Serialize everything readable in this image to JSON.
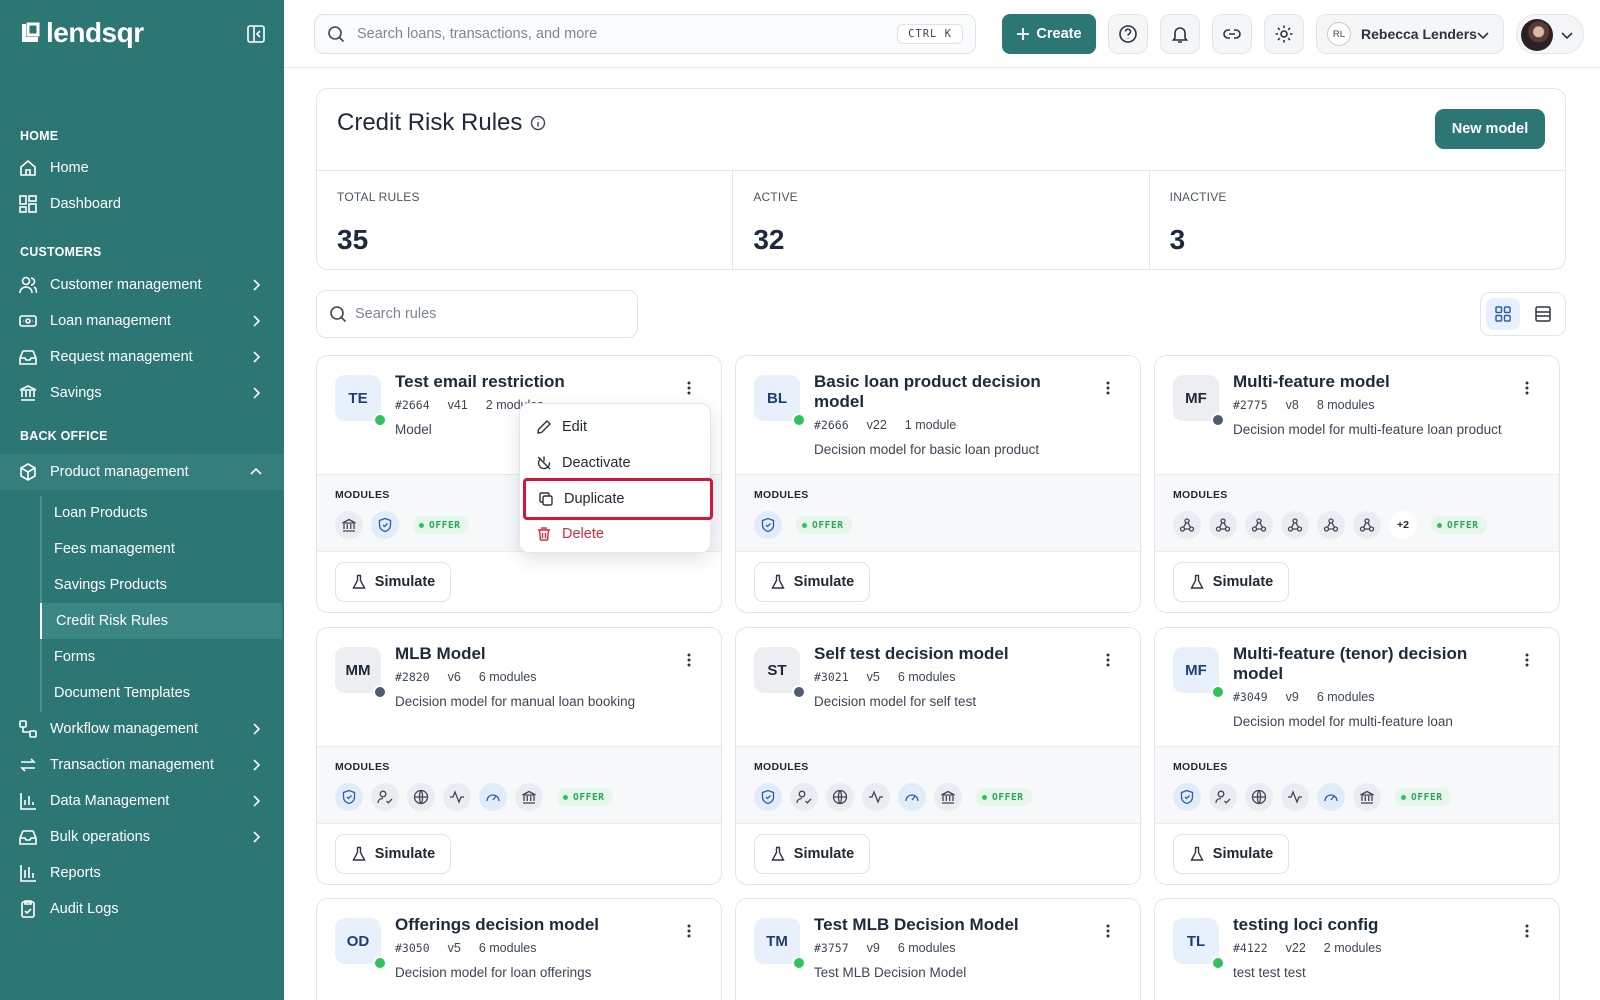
{
  "brand": {
    "name": "lendsqr"
  },
  "sidebar": {
    "sections": [
      {
        "label": "HOME"
      },
      {
        "label": "CUSTOMERS"
      },
      {
        "label": "BACK OFFICE"
      }
    ],
    "items": [
      {
        "label": "Home",
        "icon": "home-icon"
      },
      {
        "label": "Dashboard",
        "icon": "dashboard-icon"
      },
      {
        "label": "Customer management",
        "icon": "users-icon"
      },
      {
        "label": "Loan management",
        "icon": "loan-icon"
      },
      {
        "label": "Request management",
        "icon": "inbox-icon"
      },
      {
        "label": "Savings",
        "icon": "piggy-bank-icon"
      },
      {
        "label": "Product management",
        "icon": "box-icon"
      },
      {
        "label": "Workflow management",
        "icon": "workflow-icon"
      },
      {
        "label": "Transaction management",
        "icon": "transfer-icon"
      },
      {
        "label": "Data Management",
        "icon": "chart-icon"
      },
      {
        "label": "Bulk operations",
        "icon": "inbox-icon"
      },
      {
        "label": "Reports",
        "icon": "bar-chart-icon"
      },
      {
        "label": "Audit Logs",
        "icon": "clipboard-icon"
      }
    ],
    "sub_items": [
      {
        "label": "Loan Products"
      },
      {
        "label": "Fees management"
      },
      {
        "label": "Savings Products"
      },
      {
        "label": "Credit Risk Rules",
        "active": true
      },
      {
        "label": "Forms"
      },
      {
        "label": "Document Templates"
      }
    ]
  },
  "topbar": {
    "search_placeholder": "Search loans, transactions, and more",
    "shortcut": "CTRL K",
    "create_label": "Create",
    "user_initials": "RL",
    "user_name": "Rebecca Lenders"
  },
  "page": {
    "title": "Credit Risk Rules",
    "new_model_label": "New model",
    "stats": [
      {
        "label": "TOTAL RULES",
        "value": "35"
      },
      {
        "label": "ACTIVE",
        "value": "32"
      },
      {
        "label": "INACTIVE",
        "value": "3"
      }
    ],
    "search_placeholder": "Search rules"
  },
  "labels": {
    "modules": "MODULES",
    "simulate": "Simulate",
    "offer": "OFFER"
  },
  "cards": [
    {
      "initials": "TE",
      "title": "Test email restriction",
      "id": "#2664",
      "version": "v41",
      "modules": "2 modules",
      "desc": "Model",
      "status": "active"
    },
    {
      "initials": "BL",
      "title": "Basic loan product decision model",
      "id": "#2666",
      "version": "v22",
      "modules": "1 module",
      "desc": "Decision model for basic loan product",
      "status": "active"
    },
    {
      "initials": "MF",
      "title": "Multi-feature model",
      "id": "#2775",
      "version": "v8",
      "modules": "8 modules",
      "desc": "Decision model for multi-feature loan product",
      "status": "inactive",
      "more": "+2"
    },
    {
      "initials": "MM",
      "title": "MLB Model",
      "id": "#2820",
      "version": "v6",
      "modules": "6 modules",
      "desc": "Decision model for manual loan booking",
      "status": "inactive"
    },
    {
      "initials": "ST",
      "title": "Self test decision model",
      "id": "#3021",
      "version": "v5",
      "modules": "6 modules",
      "desc": "Decision model for self test",
      "status": "inactive"
    },
    {
      "initials": "MF",
      "title": "Multi-feature (tenor) decision model",
      "id": "#3049",
      "version": "v9",
      "modules": "6 modules",
      "desc": "Decision model for multi-feature loan",
      "status": "active"
    },
    {
      "initials": "OD",
      "title": "Offerings decision model",
      "id": "#3050",
      "version": "v5",
      "modules": "6 modules",
      "desc": "Decision model for loan offerings",
      "status": "active"
    },
    {
      "initials": "TM",
      "title": "Test MLB Decision Model",
      "id": "#3757",
      "version": "v9",
      "modules": "6 modules",
      "desc": "Test MLB Decision Model",
      "status": "active"
    },
    {
      "initials": "TL",
      "title": "testing loci config",
      "id": "#4122",
      "version": "v22",
      "modules": "2 modules",
      "desc": "test test test",
      "status": "active"
    }
  ],
  "menu": {
    "items": [
      {
        "label": "Edit",
        "icon": "pencil-icon"
      },
      {
        "label": "Deactivate",
        "icon": "power-off-icon"
      },
      {
        "label": "Duplicate",
        "icon": "copy-icon",
        "highlighted": true
      },
      {
        "label": "Delete",
        "icon": "trash-icon"
      }
    ]
  },
  "colors": {
    "brand": "#2c7673",
    "active": "#2fc35a",
    "inactive": "#4f5a73",
    "danger": "#d92b3a",
    "highlight": "#d4163c"
  }
}
